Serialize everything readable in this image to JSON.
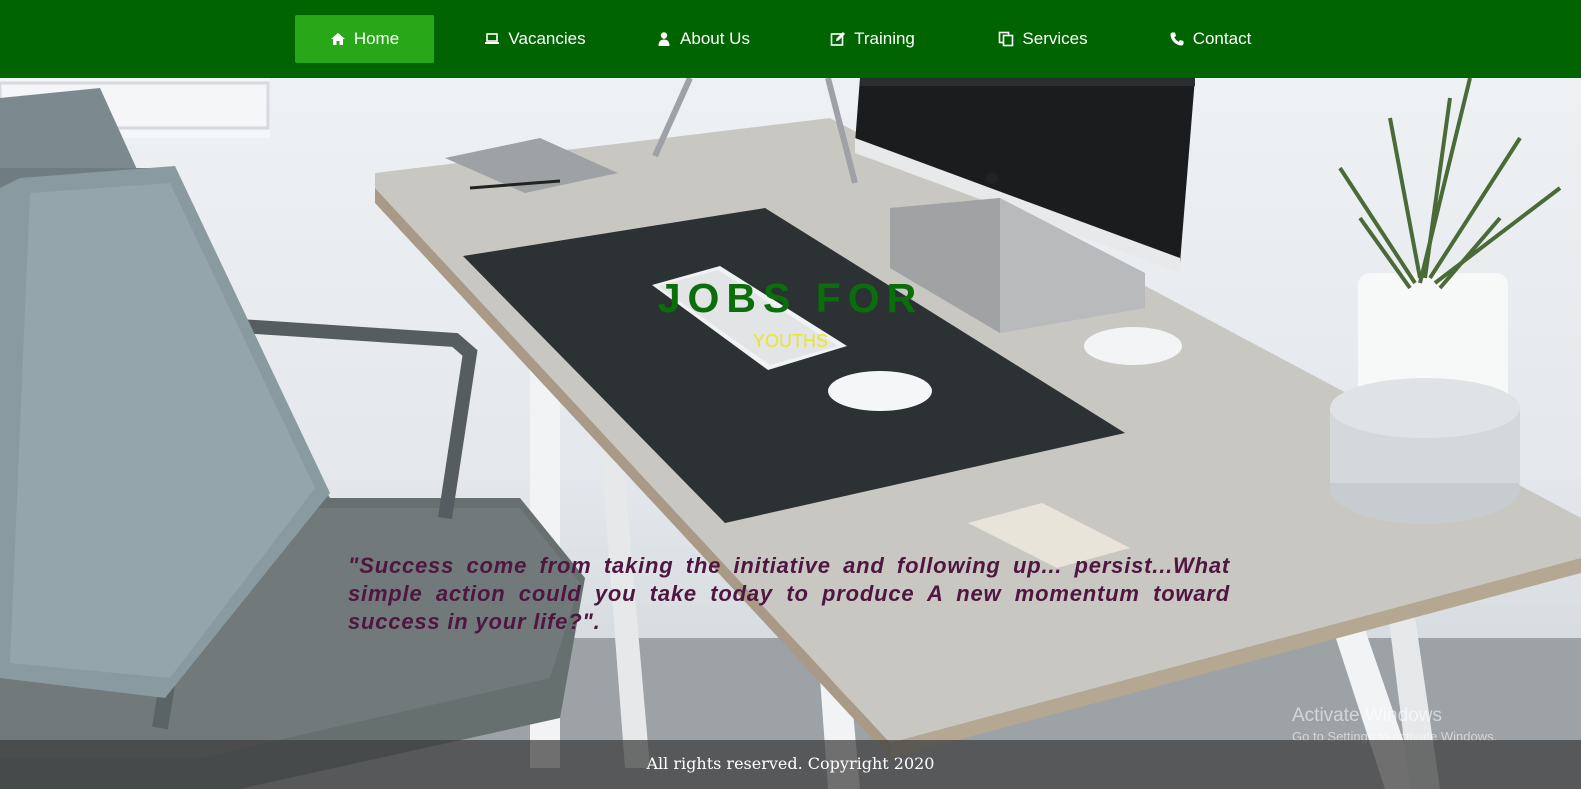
{
  "nav": {
    "items": [
      {
        "label": "Home",
        "icon": "home-icon",
        "active": true
      },
      {
        "label": "Vacancies",
        "icon": "laptop-icon",
        "active": false
      },
      {
        "label": "About Us",
        "icon": "user-icon",
        "active": false
      },
      {
        "label": "Training",
        "icon": "edit-icon",
        "active": false
      },
      {
        "label": "Services",
        "icon": "copy-icon",
        "active": false
      },
      {
        "label": "Contact",
        "icon": "phone-icon",
        "active": false
      }
    ],
    "background": "#006400",
    "active_background": "#28a818"
  },
  "hero": {
    "title": "JOBS FOR",
    "subtitle": "YOUTHS",
    "quote": "\"Success come from taking the initiative and following up... persist...What simple action could you take today to produce A new momentum toward success in your life?\"."
  },
  "footer": {
    "text": "All rights reserved. Copyright 2020"
  },
  "watermark": {
    "line1": "Activate Windows",
    "line2": "Go to Settings to activate Windows."
  },
  "colors": {
    "title": "#0a6e0a",
    "subtitle": "#e6e62a",
    "quote": "#4e1640"
  }
}
